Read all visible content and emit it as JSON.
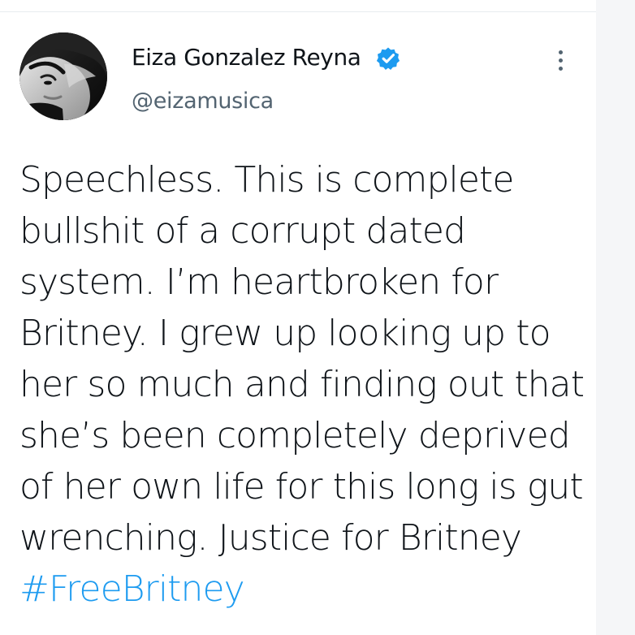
{
  "tweet": {
    "author": {
      "name": "Eiza Gonzalez Reyna",
      "handle": "@eizamusica",
      "verified": true,
      "verified_icon": "verified-badge-icon",
      "avatar_icon": "profile-avatar"
    },
    "more_icon": "more-options-icon",
    "body_lines": [
      "Speechless. This is complete",
      "bullshit of a corrupt dated",
      "system. I’m heartbroken for",
      "Britney. I grew up looking up to",
      "her so much and finding out that",
      "she’s been completely deprived",
      "of her own life for this long is gut",
      "wrenching. Justice for Britney"
    ],
    "hashtag": "#FreeBritney"
  },
  "colors": {
    "text": "#0f1419",
    "secondary": "#536471",
    "accent": "#1d9bf0",
    "background": "#ffffff",
    "gutter": "#f5f6f8"
  }
}
